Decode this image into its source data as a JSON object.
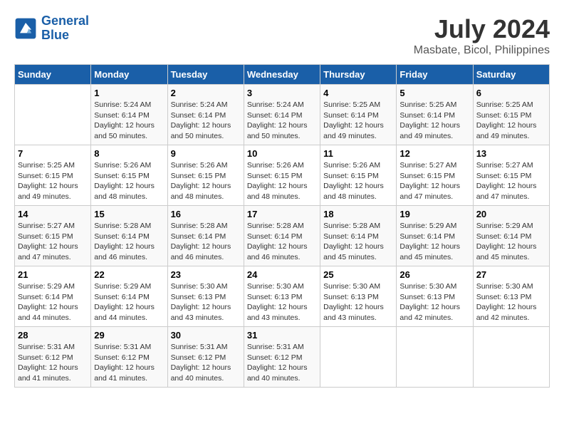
{
  "header": {
    "logo_line1": "General",
    "logo_line2": "Blue",
    "month_title": "July 2024",
    "subtitle": "Masbate, Bicol, Philippines"
  },
  "days_of_week": [
    "Sunday",
    "Monday",
    "Tuesday",
    "Wednesday",
    "Thursday",
    "Friday",
    "Saturday"
  ],
  "weeks": [
    [
      {
        "day": "",
        "info": ""
      },
      {
        "day": "1",
        "info": "Sunrise: 5:24 AM\nSunset: 6:14 PM\nDaylight: 12 hours\nand 50 minutes."
      },
      {
        "day": "2",
        "info": "Sunrise: 5:24 AM\nSunset: 6:14 PM\nDaylight: 12 hours\nand 50 minutes."
      },
      {
        "day": "3",
        "info": "Sunrise: 5:24 AM\nSunset: 6:14 PM\nDaylight: 12 hours\nand 50 minutes."
      },
      {
        "day": "4",
        "info": "Sunrise: 5:25 AM\nSunset: 6:14 PM\nDaylight: 12 hours\nand 49 minutes."
      },
      {
        "day": "5",
        "info": "Sunrise: 5:25 AM\nSunset: 6:14 PM\nDaylight: 12 hours\nand 49 minutes."
      },
      {
        "day": "6",
        "info": "Sunrise: 5:25 AM\nSunset: 6:15 PM\nDaylight: 12 hours\nand 49 minutes."
      }
    ],
    [
      {
        "day": "7",
        "info": "Sunrise: 5:25 AM\nSunset: 6:15 PM\nDaylight: 12 hours\nand 49 minutes."
      },
      {
        "day": "8",
        "info": "Sunrise: 5:26 AM\nSunset: 6:15 PM\nDaylight: 12 hours\nand 48 minutes."
      },
      {
        "day": "9",
        "info": "Sunrise: 5:26 AM\nSunset: 6:15 PM\nDaylight: 12 hours\nand 48 minutes."
      },
      {
        "day": "10",
        "info": "Sunrise: 5:26 AM\nSunset: 6:15 PM\nDaylight: 12 hours\nand 48 minutes."
      },
      {
        "day": "11",
        "info": "Sunrise: 5:26 AM\nSunset: 6:15 PM\nDaylight: 12 hours\nand 48 minutes."
      },
      {
        "day": "12",
        "info": "Sunrise: 5:27 AM\nSunset: 6:15 PM\nDaylight: 12 hours\nand 47 minutes."
      },
      {
        "day": "13",
        "info": "Sunrise: 5:27 AM\nSunset: 6:15 PM\nDaylight: 12 hours\nand 47 minutes."
      }
    ],
    [
      {
        "day": "14",
        "info": "Sunrise: 5:27 AM\nSunset: 6:15 PM\nDaylight: 12 hours\nand 47 minutes."
      },
      {
        "day": "15",
        "info": "Sunrise: 5:28 AM\nSunset: 6:14 PM\nDaylight: 12 hours\nand 46 minutes."
      },
      {
        "day": "16",
        "info": "Sunrise: 5:28 AM\nSunset: 6:14 PM\nDaylight: 12 hours\nand 46 minutes."
      },
      {
        "day": "17",
        "info": "Sunrise: 5:28 AM\nSunset: 6:14 PM\nDaylight: 12 hours\nand 46 minutes."
      },
      {
        "day": "18",
        "info": "Sunrise: 5:28 AM\nSunset: 6:14 PM\nDaylight: 12 hours\nand 45 minutes."
      },
      {
        "day": "19",
        "info": "Sunrise: 5:29 AM\nSunset: 6:14 PM\nDaylight: 12 hours\nand 45 minutes."
      },
      {
        "day": "20",
        "info": "Sunrise: 5:29 AM\nSunset: 6:14 PM\nDaylight: 12 hours\nand 45 minutes."
      }
    ],
    [
      {
        "day": "21",
        "info": "Sunrise: 5:29 AM\nSunset: 6:14 PM\nDaylight: 12 hours\nand 44 minutes."
      },
      {
        "day": "22",
        "info": "Sunrise: 5:29 AM\nSunset: 6:14 PM\nDaylight: 12 hours\nand 44 minutes."
      },
      {
        "day": "23",
        "info": "Sunrise: 5:30 AM\nSunset: 6:13 PM\nDaylight: 12 hours\nand 43 minutes."
      },
      {
        "day": "24",
        "info": "Sunrise: 5:30 AM\nSunset: 6:13 PM\nDaylight: 12 hours\nand 43 minutes."
      },
      {
        "day": "25",
        "info": "Sunrise: 5:30 AM\nSunset: 6:13 PM\nDaylight: 12 hours\nand 43 minutes."
      },
      {
        "day": "26",
        "info": "Sunrise: 5:30 AM\nSunset: 6:13 PM\nDaylight: 12 hours\nand 42 minutes."
      },
      {
        "day": "27",
        "info": "Sunrise: 5:30 AM\nSunset: 6:13 PM\nDaylight: 12 hours\nand 42 minutes."
      }
    ],
    [
      {
        "day": "28",
        "info": "Sunrise: 5:31 AM\nSunset: 6:12 PM\nDaylight: 12 hours\nand 41 minutes."
      },
      {
        "day": "29",
        "info": "Sunrise: 5:31 AM\nSunset: 6:12 PM\nDaylight: 12 hours\nand 41 minutes."
      },
      {
        "day": "30",
        "info": "Sunrise: 5:31 AM\nSunset: 6:12 PM\nDaylight: 12 hours\nand 40 minutes."
      },
      {
        "day": "31",
        "info": "Sunrise: 5:31 AM\nSunset: 6:12 PM\nDaylight: 12 hours\nand 40 minutes."
      },
      {
        "day": "",
        "info": ""
      },
      {
        "day": "",
        "info": ""
      },
      {
        "day": "",
        "info": ""
      }
    ]
  ]
}
